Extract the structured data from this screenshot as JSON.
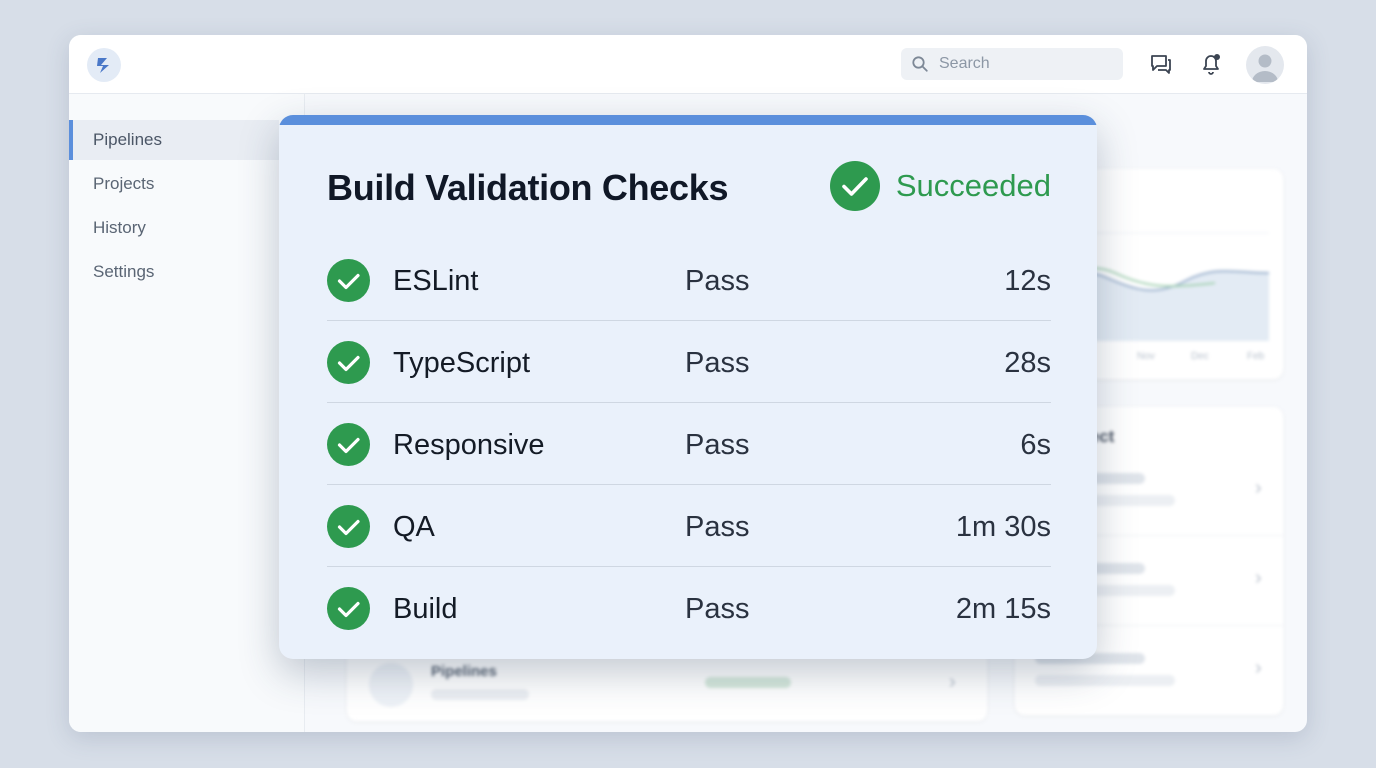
{
  "topbar": {
    "search_placeholder": "Search"
  },
  "sidebar": {
    "items": [
      {
        "label": "Pipelines",
        "active": true
      },
      {
        "label": "Projects"
      },
      {
        "label": "History"
      },
      {
        "label": "Settings"
      }
    ]
  },
  "background": {
    "card_project_title": "ject",
    "chart_ticks": [
      "Nov",
      "Dec",
      "Feb"
    ],
    "pipelines_label": "Pipelines"
  },
  "modal": {
    "title": "Build Validation Checks",
    "status": "Succeeded",
    "accent_color": "#5b8fdc",
    "success_color": "#2e9a4f",
    "checks": [
      {
        "name": "ESLint",
        "result": "Pass",
        "duration": "12s"
      },
      {
        "name": "TypeScript",
        "result": "Pass",
        "duration": "28s"
      },
      {
        "name": "Responsive",
        "result": "Pass",
        "duration": "6s"
      },
      {
        "name": "QA",
        "result": "Pass",
        "duration": "1m 30s"
      },
      {
        "name": "Build",
        "result": "Pass",
        "duration": "2m 15s"
      }
    ]
  },
  "icons": {
    "logo": "app-logo-icon",
    "search": "search-icon",
    "messages": "chat-icon",
    "notifications": "bell-icon",
    "avatar": "user-avatar-icon",
    "check": "check-circle-icon"
  }
}
